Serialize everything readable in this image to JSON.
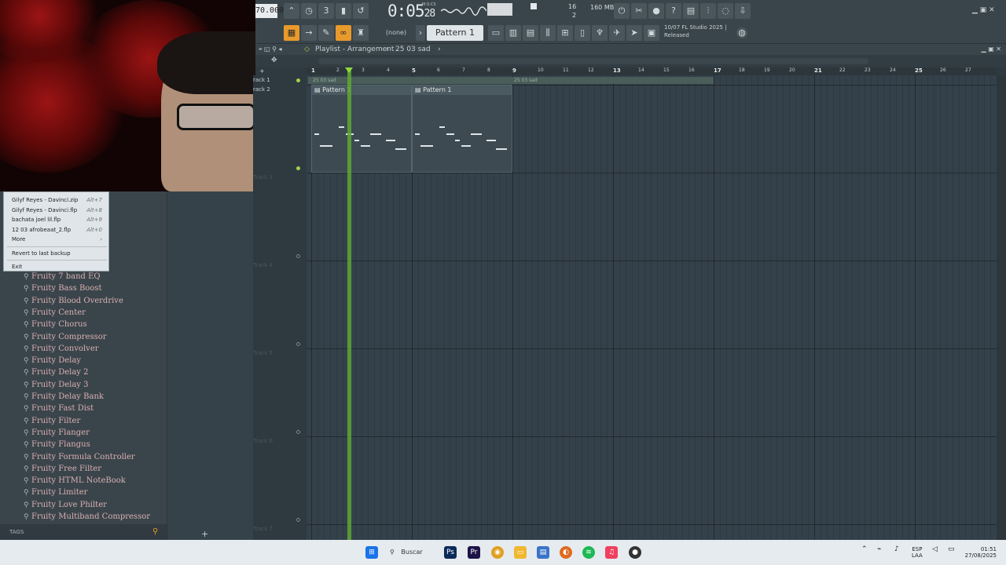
{
  "toolbar": {
    "tempo": "70.000",
    "time_main": "0:05",
    "time_sub": "28",
    "time_unit": "M:S:CS",
    "cpu_top": "16",
    "cpu_bottom": "2",
    "memory": "160 MB",
    "none_label": "(none)",
    "pattern_label": "Pattern 1",
    "news_line1": "10/07  FL Studio 2025 |",
    "news_line2": "Released"
  },
  "menu": {
    "items": [
      {
        "label": "Gilyf Reyes - Davinci.zip",
        "shortcut": "Alt+7"
      },
      {
        "label": "Gilyf Reyes - Davinci.flp",
        "shortcut": "Alt+8"
      },
      {
        "label": "bachata joel lil.flp",
        "shortcut": "Alt+9"
      },
      {
        "label": "12 03 afrobeaat_2.flp",
        "shortcut": "Alt+0"
      },
      {
        "label": "More",
        "shortcut": "›"
      }
    ],
    "revert": "Revert to last backup",
    "exit": "Exit"
  },
  "browser": {
    "plugins": [
      "Fruity 7 band EQ",
      "Fruity Bass Boost",
      "Fruity Blood Overdrive",
      "Fruity Center",
      "Fruity Chorus",
      "Fruity Compressor",
      "Fruity Convolver",
      "Fruity Delay",
      "Fruity Delay 2",
      "Fruity Delay 3",
      "Fruity Delay Bank",
      "Fruity Fast Dist",
      "Fruity Filter",
      "Fruity Flanger",
      "Fruity Flangus",
      "Fruity Formula Controller",
      "Fruity Free Filter",
      "Fruity HTML NoteBook",
      "Fruity Limiter",
      "Fruity Love Philter",
      "Fruity Multiband Compressor"
    ],
    "tags_label": "TAGS",
    "add_label": "+"
  },
  "playlist": {
    "title": "Playlist - Arrangement",
    "breadcrumb": "25 03 sad",
    "marker_label": "25 03 sad",
    "ruler": [
      "1",
      "2",
      "3",
      "4",
      "5",
      "6",
      "7",
      "8",
      "9",
      "10",
      "11",
      "12",
      "13",
      "14",
      "15",
      "16",
      "17",
      "18",
      "19",
      "20",
      "21",
      "22",
      "23",
      "24",
      "25",
      "26",
      "27"
    ],
    "tracks": [
      "rack 1",
      "rack 2",
      "Track 3",
      "Track 4",
      "Track 5",
      "Track 6",
      "Track 7"
    ],
    "clips": [
      {
        "label": "Pattern 1"
      },
      {
        "label": "Pattern 1"
      }
    ]
  },
  "taskbar": {
    "search_label": "Buscar",
    "lang_top": "ESP",
    "lang_bottom": "LAA",
    "clock_time": "01:51",
    "clock_date": "27/08/2025"
  },
  "colors": {
    "accent": "#e89a2b",
    "playhead": "#8fd93f",
    "plugin_text": "#d9b0b2"
  }
}
